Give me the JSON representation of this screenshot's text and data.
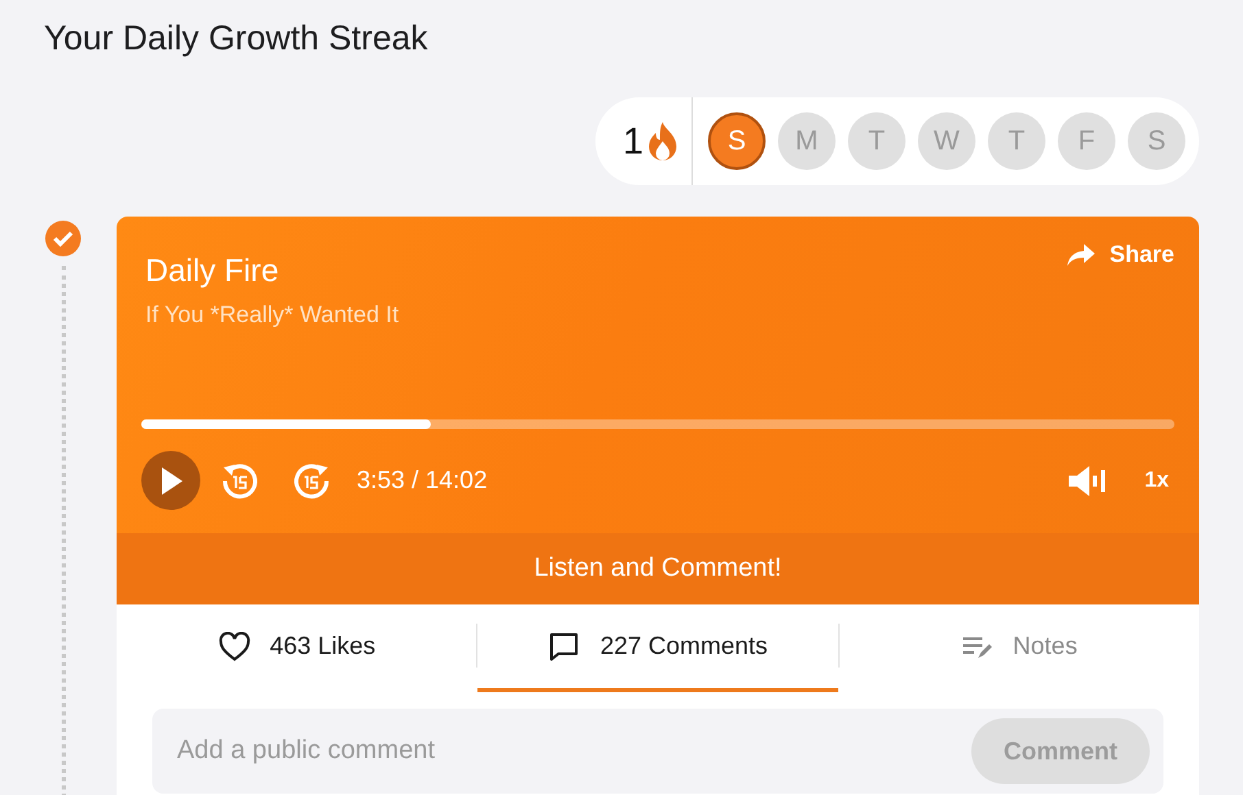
{
  "heading": "Your Daily Growth Streak",
  "streak": {
    "count": "1",
    "days": [
      {
        "letter": "S",
        "selected": true
      },
      {
        "letter": "M",
        "selected": false
      },
      {
        "letter": "T",
        "selected": false
      },
      {
        "letter": "W",
        "selected": false
      },
      {
        "letter": "T",
        "selected": false
      },
      {
        "letter": "F",
        "selected": false
      },
      {
        "letter": "S",
        "selected": false
      }
    ]
  },
  "entry": {
    "checked": true
  },
  "player": {
    "title": "Daily Fire",
    "subtitle": "If You *Really* Wanted It",
    "share": "Share",
    "level": 0.28,
    "playing": false,
    "time": "3:53 / 14:02",
    "speed": "1x",
    "banner": "Listen and Comment!"
  },
  "tabs": [
    {
      "kind": "likes",
      "label": "463 Likes",
      "selected": false,
      "disabled": false
    },
    {
      "kind": "comments",
      "label": "227 Comments",
      "selected": true,
      "disabled": false
    },
    {
      "kind": "notes",
      "label": "Notes",
      "selected": false,
      "disabled": true
    }
  ],
  "comment_box": {
    "placeholder": "Add a public comment",
    "button": "Comment",
    "disabled": true
  }
}
